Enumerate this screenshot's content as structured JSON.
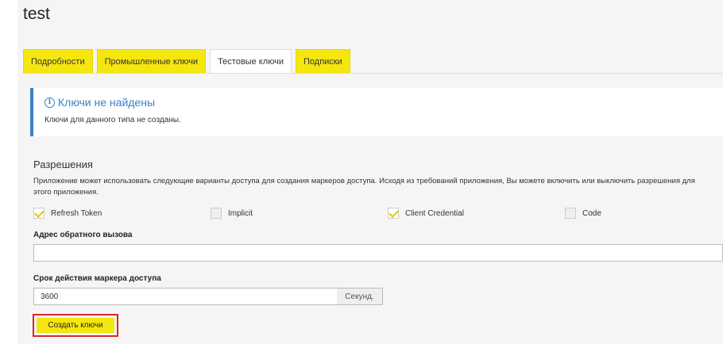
{
  "app": {
    "title": "test"
  },
  "tabs": [
    {
      "label": "Подробности",
      "active": false
    },
    {
      "label": "Промышленные ключи",
      "active": false
    },
    {
      "label": "Тестовые ключи",
      "active": true
    },
    {
      "label": "Подписки",
      "active": false
    }
  ],
  "alert": {
    "title": "Ключи не найдены",
    "text": "Ключи для данного типа не созданы.",
    "icon": "info-icon",
    "color": "#3b82c4"
  },
  "permissions": {
    "title": "Разрешения",
    "description": "Приложение может использовать следующие варианты доступа для создания маркеров доступа. Исходя из требований приложения, Вы можете включить или выключить разрешения для этого приложения.",
    "options": [
      {
        "label": "Refresh Token",
        "checked": true
      },
      {
        "label": "Implicit",
        "checked": false
      },
      {
        "label": "Client Credential",
        "checked": true
      },
      {
        "label": "Code",
        "checked": false
      }
    ]
  },
  "callback": {
    "label": "Адрес обратного вызова",
    "value": ""
  },
  "token_expiry": {
    "label": "Срок действия маркера доступа",
    "value": "3600",
    "unit": "Секунд."
  },
  "submit": {
    "label": "Создать ключи"
  },
  "colors": {
    "accent": "#f5e60e",
    "info": "#3b82c4",
    "highlight": "#d9262b"
  }
}
